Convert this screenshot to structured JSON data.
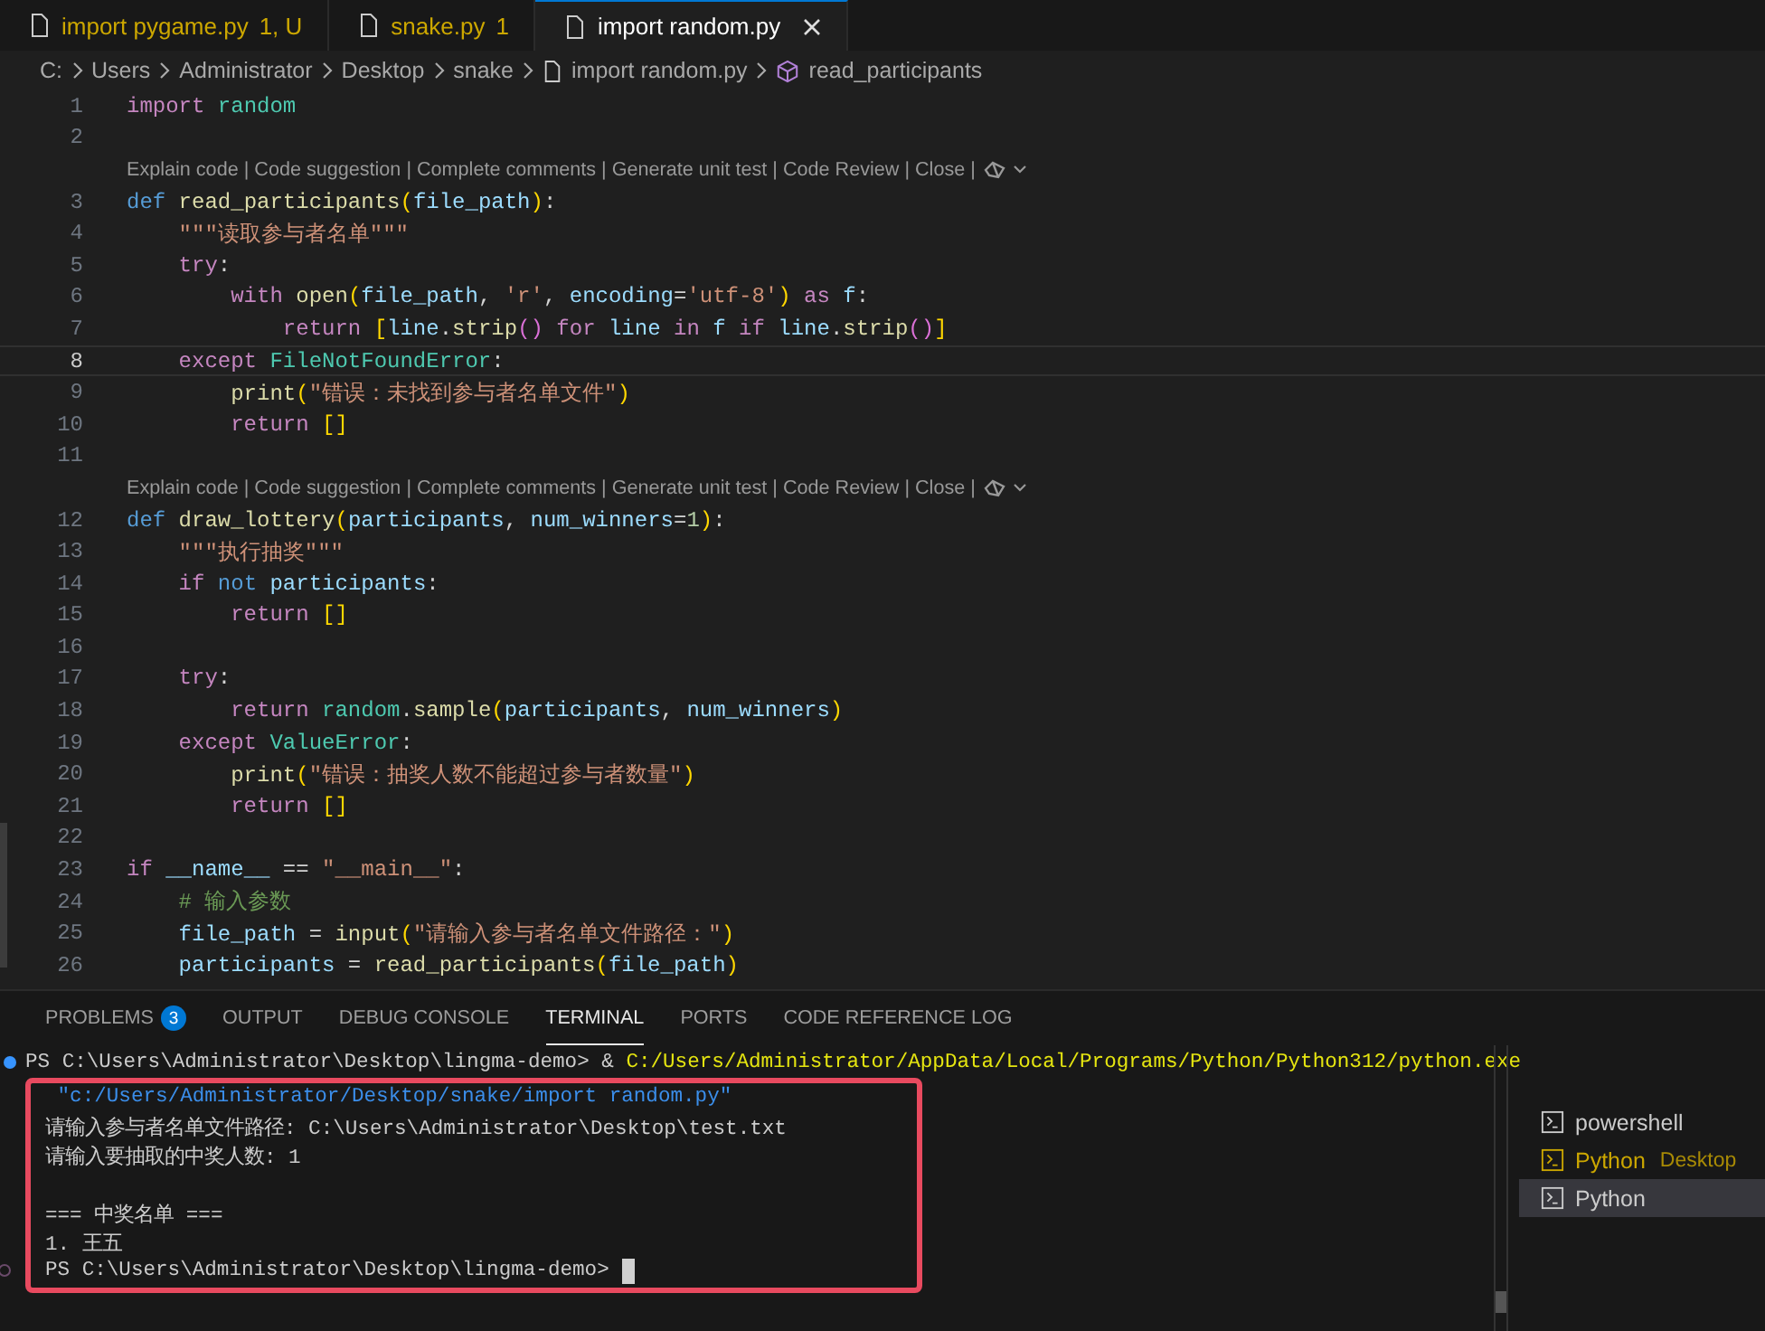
{
  "tabs": [
    {
      "label": "import pygame.py",
      "status": "1, U",
      "warning": true,
      "selected": false
    },
    {
      "label": "snake.py",
      "status": "1",
      "warning": true,
      "selected": false
    },
    {
      "label": "import random.py",
      "warning": false,
      "selected": true
    }
  ],
  "breadcrumb": [
    {
      "kind": "folder",
      "label": "C:"
    },
    {
      "kind": "folder",
      "label": "Users"
    },
    {
      "kind": "folder",
      "label": "Administrator"
    },
    {
      "kind": "folder",
      "label": "Desktop"
    },
    {
      "kind": "folder",
      "label": "snake"
    },
    {
      "kind": "file",
      "label": "import random.py"
    },
    {
      "kind": "symbol",
      "label": "read_participants"
    }
  ],
  "editor": {
    "lines": [
      {
        "kind": "code",
        "number": "1",
        "current": false,
        "tokens": [
          {
            "kind": "kw",
            "t": "import"
          },
          {
            "kind": "cls",
            "t": " random"
          }
        ]
      },
      {
        "kind": "code",
        "number": "2",
        "current": false
      },
      {
        "kind": "lens",
        "actions": [
          "Explain code",
          "Code suggestion",
          "Complete comments",
          "Generate unit test",
          "Code Review",
          "Close"
        ],
        "separator": "|"
      },
      {
        "kind": "code",
        "number": "3",
        "current": false,
        "tokens": [
          {
            "kind": "def",
            "t": "def"
          },
          {
            "kind": "fn",
            "t": " read_participants"
          },
          {
            "kind": "br1",
            "t": "("
          },
          {
            "kind": "var",
            "t": "file_path"
          },
          {
            "kind": "br1",
            "t": ")"
          },
          {
            "kind": "op",
            "t": ":"
          }
        ]
      },
      {
        "kind": "code",
        "number": "4",
        "current": false,
        "tokens": [
          {
            "kind": "str",
            "t": "    \"\"\"读取参与者名单\"\"\""
          }
        ]
      },
      {
        "kind": "code",
        "number": "5",
        "current": false,
        "tokens": [
          {
            "kind": "kw",
            "t": "    try"
          },
          {
            "kind": "op",
            "t": ":"
          }
        ]
      },
      {
        "kind": "code",
        "number": "6",
        "current": false,
        "tokens": [
          {
            "kind": "kw",
            "t": "        with"
          },
          {
            "kind": "fn",
            "t": " open"
          },
          {
            "kind": "br1",
            "t": "("
          },
          {
            "kind": "var",
            "t": "file_path"
          },
          {
            "kind": "op",
            "t": ", "
          },
          {
            "kind": "str",
            "t": "'r'"
          },
          {
            "kind": "op",
            "t": ", "
          },
          {
            "kind": "var",
            "t": "encoding"
          },
          {
            "kind": "op",
            "t": "="
          },
          {
            "kind": "str",
            "t": "'utf-8'"
          },
          {
            "kind": "br1",
            "t": ")"
          },
          {
            "kind": "kw",
            "t": " as"
          },
          {
            "kind": "var",
            "t": " f"
          },
          {
            "kind": "op",
            "t": ":"
          }
        ]
      },
      {
        "kind": "code",
        "number": "7",
        "current": false,
        "tokens": [
          {
            "kind": "kw",
            "t": "            return"
          },
          {
            "kind": "br1",
            "t": " ["
          },
          {
            "kind": "var",
            "t": "line"
          },
          {
            "kind": "op",
            "t": "."
          },
          {
            "kind": "fn",
            "t": "strip"
          },
          {
            "kind": "br2",
            "t": "()"
          },
          {
            "kind": "kw",
            "t": " for"
          },
          {
            "kind": "var",
            "t": " line"
          },
          {
            "kind": "kw",
            "t": " in"
          },
          {
            "kind": "var",
            "t": " f"
          },
          {
            "kind": "kw",
            "t": " if"
          },
          {
            "kind": "var",
            "t": " line"
          },
          {
            "kind": "op",
            "t": "."
          },
          {
            "kind": "fn",
            "t": "strip"
          },
          {
            "kind": "br2",
            "t": "()"
          },
          {
            "kind": "br1",
            "t": "]"
          }
        ]
      },
      {
        "kind": "code",
        "number": "8",
        "current": true,
        "tokens": [
          {
            "kind": "kw",
            "t": "    except"
          },
          {
            "kind": "cls",
            "t": " FileNotFoundError"
          },
          {
            "kind": "op",
            "t": ":"
          }
        ]
      },
      {
        "kind": "code",
        "number": "9",
        "current": false,
        "tokens": [
          {
            "kind": "fn",
            "t": "        print"
          },
          {
            "kind": "br1",
            "t": "("
          },
          {
            "kind": "str",
            "t": "\"错误：未找到参与者名单文件\""
          },
          {
            "kind": "br1",
            "t": ")"
          }
        ]
      },
      {
        "kind": "code",
        "number": "10",
        "current": false,
        "tokens": [
          {
            "kind": "kw",
            "t": "        return"
          },
          {
            "kind": "br1",
            "t": " []"
          }
        ]
      },
      {
        "kind": "code",
        "number": "11",
        "current": false
      },
      {
        "kind": "lens",
        "actions": [
          "Explain code",
          "Code suggestion",
          "Complete comments",
          "Generate unit test",
          "Code Review",
          "Close"
        ],
        "separator": "|"
      },
      {
        "kind": "code",
        "number": "12",
        "current": false,
        "tokens": [
          {
            "kind": "def",
            "t": "def"
          },
          {
            "kind": "fn",
            "t": " draw_lottery"
          },
          {
            "kind": "br1",
            "t": "("
          },
          {
            "kind": "var",
            "t": "participants"
          },
          {
            "kind": "op",
            "t": ", "
          },
          {
            "kind": "var",
            "t": "num_winners"
          },
          {
            "kind": "op",
            "t": "="
          },
          {
            "kind": "num",
            "t": "1"
          },
          {
            "kind": "br1",
            "t": ")"
          },
          {
            "kind": "op",
            "t": ":"
          }
        ]
      },
      {
        "kind": "code",
        "number": "13",
        "current": false,
        "tokens": [
          {
            "kind": "str",
            "t": "    \"\"\"执行抽奖\"\"\""
          }
        ]
      },
      {
        "kind": "code",
        "number": "14",
        "current": false,
        "tokens": [
          {
            "kind": "kw",
            "t": "    if"
          },
          {
            "kind": "def",
            "t": " not"
          },
          {
            "kind": "var",
            "t": " participants"
          },
          {
            "kind": "op",
            "t": ":"
          }
        ]
      },
      {
        "kind": "code",
        "number": "15",
        "current": false,
        "tokens": [
          {
            "kind": "kw",
            "t": "        return"
          },
          {
            "kind": "br1",
            "t": " []"
          }
        ]
      },
      {
        "kind": "code",
        "number": "16",
        "current": false
      },
      {
        "kind": "code",
        "number": "17",
        "current": false,
        "tokens": [
          {
            "kind": "kw",
            "t": "    try"
          },
          {
            "kind": "op",
            "t": ":"
          }
        ]
      },
      {
        "kind": "code",
        "number": "18",
        "current": false,
        "tokens": [
          {
            "kind": "kw",
            "t": "        return"
          },
          {
            "kind": "cls",
            "t": " random"
          },
          {
            "kind": "op",
            "t": "."
          },
          {
            "kind": "fn",
            "t": "sample"
          },
          {
            "kind": "br1",
            "t": "("
          },
          {
            "kind": "var",
            "t": "participants"
          },
          {
            "kind": "op",
            "t": ", "
          },
          {
            "kind": "var",
            "t": "num_winners"
          },
          {
            "kind": "br1",
            "t": ")"
          }
        ]
      },
      {
        "kind": "code",
        "number": "19",
        "current": false,
        "tokens": [
          {
            "kind": "kw",
            "t": "    except"
          },
          {
            "kind": "cls",
            "t": " ValueError"
          },
          {
            "kind": "op",
            "t": ":"
          }
        ]
      },
      {
        "kind": "code",
        "number": "20",
        "current": false,
        "tokens": [
          {
            "kind": "fn",
            "t": "        print"
          },
          {
            "kind": "br1",
            "t": "("
          },
          {
            "kind": "str",
            "t": "\"错误：抽奖人数不能超过参与者数量\""
          },
          {
            "kind": "br1",
            "t": ")"
          }
        ]
      },
      {
        "kind": "code",
        "number": "21",
        "current": false,
        "tokens": [
          {
            "kind": "kw",
            "t": "        return"
          },
          {
            "kind": "br1",
            "t": " []"
          }
        ]
      },
      {
        "kind": "code",
        "number": "22",
        "current": false
      },
      {
        "kind": "code",
        "number": "23",
        "current": false,
        "tokens": [
          {
            "kind": "kw",
            "t": "if"
          },
          {
            "kind": "var",
            "t": " __name__"
          },
          {
            "kind": "op",
            "t": " == "
          },
          {
            "kind": "str",
            "t": "\"__main__\""
          },
          {
            "kind": "op",
            "t": ":"
          }
        ]
      },
      {
        "kind": "code",
        "number": "24",
        "current": false,
        "tokens": [
          {
            "kind": "cmt",
            "t": "    # 输入参数"
          }
        ]
      },
      {
        "kind": "code",
        "number": "25",
        "current": false,
        "tokens": [
          {
            "kind": "var",
            "t": "    file_path"
          },
          {
            "kind": "op",
            "t": " = "
          },
          {
            "kind": "fn",
            "t": "input"
          },
          {
            "kind": "br1",
            "t": "("
          },
          {
            "kind": "str",
            "t": "\"请输入参与者名单文件路径：\""
          },
          {
            "kind": "br1",
            "t": ")"
          }
        ]
      },
      {
        "kind": "code",
        "number": "26",
        "current": false,
        "tokens": [
          {
            "kind": "var",
            "t": "    participants"
          },
          {
            "kind": "op",
            "t": " = "
          },
          {
            "kind": "fn",
            "t": "read_participants"
          },
          {
            "kind": "br1",
            "t": "("
          },
          {
            "kind": "var",
            "t": "file_path"
          },
          {
            "kind": "br1",
            "t": ")"
          }
        ]
      }
    ]
  },
  "panel": {
    "tabs": [
      {
        "label": "PROBLEMS",
        "badge": "3",
        "selected": false
      },
      {
        "label": "OUTPUT",
        "selected": false
      },
      {
        "label": "DEBUG CONSOLE",
        "selected": false
      },
      {
        "label": "TERMINAL",
        "selected": true
      },
      {
        "label": "PORTS",
        "selected": false
      },
      {
        "label": "CODE REFERENCE LOG",
        "selected": false
      }
    ],
    "terminal": {
      "lines": [
        {
          "kind": "command",
          "succeeded": true,
          "segments": [
            {
              "kind": "plain",
              "t": "PS C:\\Users\\Administrator\\Desktop\\lingma-demo> & "
            },
            {
              "kind": "path",
              "t": "C:/Users/Administrator/AppData/Local/Programs/Python/Python312/python.exe"
            }
          ]
        }
      ],
      "highlight_box": {
        "lines": [
          {
            "kind": "text",
            "segments": [
              {
                "kind": "arg",
                "t": " \"c:/Users/Administrator/Desktop/snake/import random.py\""
              }
            ]
          },
          {
            "kind": "text",
            "segments": [
              {
                "kind": "plain",
                "t": "请输入参与者名单文件路径: C:\\Users\\Administrator\\Desktop\\test.txt"
              }
            ]
          },
          {
            "kind": "text",
            "segments": [
              {
                "kind": "plain",
                "t": "请输入要抽取的中奖人数: 1"
              }
            ]
          },
          {
            "kind": "blank"
          },
          {
            "kind": "text",
            "segments": [
              {
                "kind": "plain",
                "t": "=== 中奖名单 ==="
              }
            ]
          },
          {
            "kind": "text",
            "segments": [
              {
                "kind": "plain",
                "t": "1. 王五"
              }
            ]
          },
          {
            "kind": "command",
            "succeeded": false,
            "segments": [
              {
                "kind": "plain",
                "t": "PS C:\\Users\\Administrator\\Desktop\\lingma-demo> "
              }
            ]
          }
        ]
      },
      "cursor": true
    },
    "terminals": [
      {
        "name": "powershell",
        "color": "#cccccc",
        "selected": false
      },
      {
        "name": "Python",
        "detail": "Desktop",
        "color": "#cca700",
        "selected": false
      },
      {
        "name": "Python",
        "color": "#cccccc",
        "selected": true
      }
    ]
  }
}
